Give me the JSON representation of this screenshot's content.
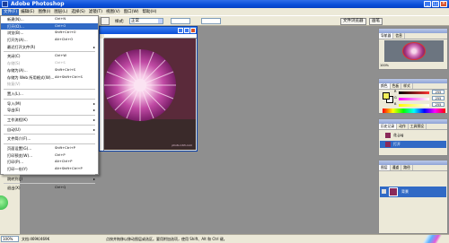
{
  "app": {
    "title": "Adobe Photoshop"
  },
  "menubar": [
    "文件(F)",
    "编辑(E)",
    "图像(I)",
    "图层(L)",
    "选择(S)",
    "滤镜(T)",
    "视图(V)",
    "窗口(W)",
    "帮助(H)"
  ],
  "options_bar": {
    "style_label": "样式:",
    "style_value": "正常",
    "tab_file_browser": "文件浏览器",
    "tab_brushes": "画笔"
  },
  "file_menu": {
    "items": [
      {
        "label": "新建(N)...",
        "shortcut": "Ctrl+N"
      },
      {
        "label": "打开(O)...",
        "shortcut": "Ctrl+O",
        "highlighted": true
      },
      {
        "label": "浏览(B)...",
        "shortcut": "Shift+Ctrl+O"
      },
      {
        "label": "打开为(A)...",
        "shortcut": "Alt+Ctrl+O"
      },
      {
        "label": "最近打开文件(R)",
        "submenu": true
      },
      {
        "sep": true
      },
      {
        "label": "关闭(C)",
        "shortcut": "Ctrl+W"
      },
      {
        "label": "存储(S)",
        "shortcut": "Ctrl+S",
        "disabled": true
      },
      {
        "label": "存储为(A)...",
        "shortcut": "Shift+Ctrl+S"
      },
      {
        "label": "存储为 Web 所用格式(W)...",
        "shortcut": "Alt+Shift+Ctrl+S"
      },
      {
        "label": "恢复(V)",
        "disabled": true
      },
      {
        "sep": true
      },
      {
        "label": "置入(L)..."
      },
      {
        "sep": true
      },
      {
        "label": "导入(M)",
        "submenu": true
      },
      {
        "label": "导出(E)",
        "submenu": true
      },
      {
        "sep": true
      },
      {
        "label": "工作流程(K)",
        "submenu": true
      },
      {
        "sep": true
      },
      {
        "label": "自动(U)",
        "submenu": true
      },
      {
        "sep": true
      },
      {
        "label": "文件简介(F)..."
      },
      {
        "sep": true
      },
      {
        "label": "页面设置(G)...",
        "shortcut": "Shift+Ctrl+P"
      },
      {
        "label": "打印预览(W)...",
        "shortcut": "Ctrl+P"
      },
      {
        "label": "打印(P)...",
        "shortcut": "Alt+Ctrl+P"
      },
      {
        "label": "打印一份(Y)",
        "shortcut": "Alt+Shift+Ctrl+P"
      },
      {
        "sep": true
      },
      {
        "label": "跳转到(J)",
        "submenu": true
      },
      {
        "sep": true
      },
      {
        "label": "退出(X)",
        "shortcut": "Ctrl+Q"
      }
    ]
  },
  "document": {
    "watermark": "photo.163.com"
  },
  "navigator": {
    "tabs": [
      "导航器",
      "信息"
    ],
    "zoom": "100%"
  },
  "color_panel": {
    "tabs": [
      "颜色",
      "色板",
      "样式"
    ],
    "channels": [
      {
        "name": "R",
        "value": "255"
      },
      {
        "name": "G",
        "value": "255"
      },
      {
        "name": "B",
        "value": "255"
      }
    ],
    "colors": {
      "foreground": "#f3f05a",
      "background": "#ffffff"
    }
  },
  "history_panel": {
    "tabs": [
      "历史记录",
      "动作",
      "工具预设"
    ],
    "rows": [
      {
        "label": "花.jpg",
        "selected": false
      },
      {
        "label": "打开",
        "selected": true
      }
    ]
  },
  "layers_panel": {
    "tabs": [
      "图层",
      "通道",
      "路径"
    ],
    "layer": "背景"
  },
  "status": {
    "zoom": "100%",
    "doc": "文档:469K/469K",
    "hint": "点按并拖移以移动图层或选区。要用附加选项，使用 Shift、Alt 和 Ctrl 键。"
  },
  "colors": {
    "title_bar": "#0a4fd8",
    "menu_highlight": "#316ac5",
    "chrome": "#ece9d8",
    "workspace": "#8f8f8f"
  }
}
